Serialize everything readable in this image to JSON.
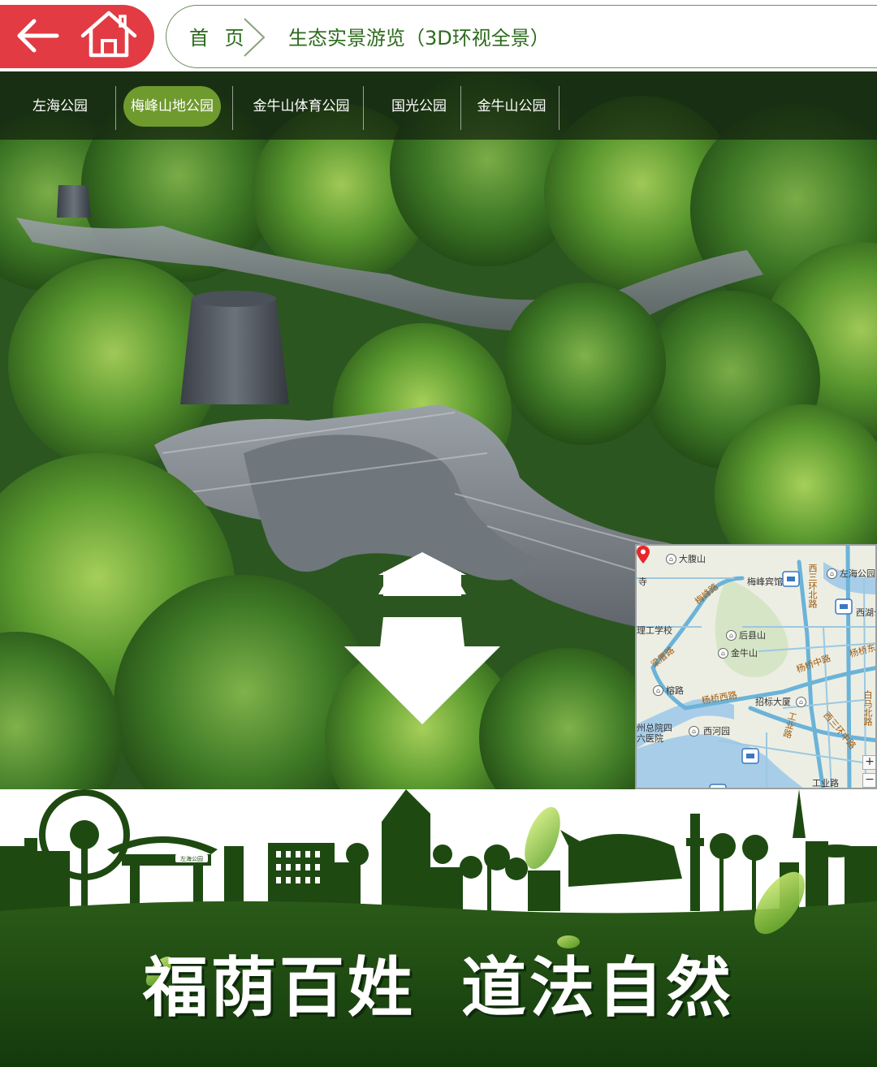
{
  "header": {
    "breadcrumb_home": "首 页",
    "breadcrumb_current": "生态实景游览（3D环视全景）"
  },
  "tabs": [
    {
      "label": "左海公园",
      "active": false
    },
    {
      "label": "梅峰山地公园",
      "active": true
    },
    {
      "label": "金牛山体育公园",
      "active": false
    },
    {
      "label": "国光公园",
      "active": false
    },
    {
      "label": "金牛山公园",
      "active": false
    }
  ],
  "map": {
    "places": {
      "dafushan": "大腹山",
      "meifeng_hotel": "梅峰宾馆",
      "zuohai_park": "左海公园",
      "xihu_park": "西湖公",
      "temple": "寺",
      "school": "理工学校",
      "houxian": "后县山",
      "jinniushan": "金牛山",
      "rongqiao": "榕路",
      "zhaobiao": "招标大厦",
      "hospital_1": "州总院四",
      "hospital_2": "六医院",
      "xiheyuan": "西河园",
      "gongye_road": "工业路"
    },
    "roads": {
      "meifeng_road": "梅峰路",
      "liangcuo_road": "梁厝路",
      "yangqiao_mid": "杨桥中路",
      "yangqiao_east": "杨桥东",
      "yangqiao_west": "杨桥西路",
      "xisanhuan_north": "西三环北路",
      "xisanhuan_mid": "西三环中路",
      "gongye_v": "工业路",
      "baima_north": "白马北路"
    },
    "zoom_in": "+",
    "zoom_out": "−"
  },
  "footer": {
    "slogan_left": "福荫百姓",
    "slogan_right": "道法自然",
    "gate_plaque": "左海公园"
  },
  "colors": {
    "brand_red": "#e23b44",
    "brand_green": "#2c6b1c",
    "active_tab": "#6f9a2e",
    "footer_green": "#1e4a12"
  }
}
